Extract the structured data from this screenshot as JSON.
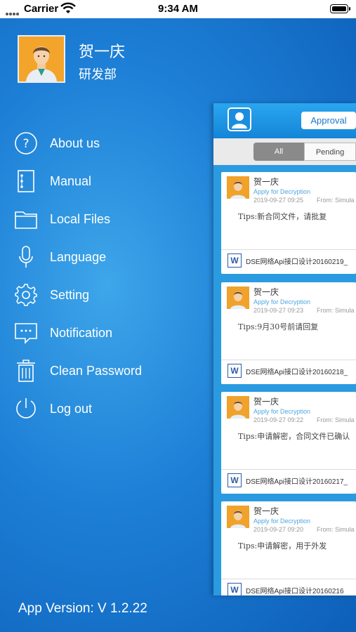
{
  "status": {
    "carrier": "Carrier",
    "time": "9:34 AM"
  },
  "profile": {
    "name": "贺一庆",
    "department": "研发部"
  },
  "menu": [
    {
      "label": "About us",
      "icon": "info-icon"
    },
    {
      "label": "Manual",
      "icon": "manual-icon"
    },
    {
      "label": "Local Files",
      "icon": "folder-icon"
    },
    {
      "label": "Language",
      "icon": "microphone-icon"
    },
    {
      "label": "Setting",
      "icon": "gear-icon"
    },
    {
      "label": "Notification",
      "icon": "notification-icon"
    },
    {
      "label": "Clean Password",
      "icon": "trash-icon"
    },
    {
      "label": "Log out",
      "icon": "power-icon"
    }
  ],
  "version": "App Version: V 1.2.22",
  "panel": {
    "approval_label": "Approval",
    "tabs": {
      "all": "All",
      "pending": "Pending"
    },
    "cards": [
      {
        "name": "贺一庆",
        "type": "Apply for Decryption",
        "date": "2019-09-27 09:25",
        "from": "From: Simula",
        "tips": "Tips:新合同文件，请批复",
        "file": "DSE网络Api接口设计20160219_"
      },
      {
        "name": "贺一庆",
        "type": "Apply for Decryption",
        "date": "2019-09-27 09:23",
        "from": "From: Simula",
        "tips": "Tips:9月30号前请回复",
        "file": "DSE网络Api接口设计20160218_"
      },
      {
        "name": "贺一庆",
        "type": "Apply for Decryption",
        "date": "2019-09-27 09:22",
        "from": "From: Simula",
        "tips": "Tips:申请解密，合同文件已确认",
        "file": "DSE网络Api接口设计20160217_"
      },
      {
        "name": "贺一庆",
        "type": "Apply for Decryption",
        "date": "2019-09-27 09:20",
        "from": "From: Simula",
        "tips": "Tips:申请解密，用于外发",
        "file": "DSE网络Api接口设计20160216"
      }
    ],
    "file_icon_letter": "W"
  }
}
